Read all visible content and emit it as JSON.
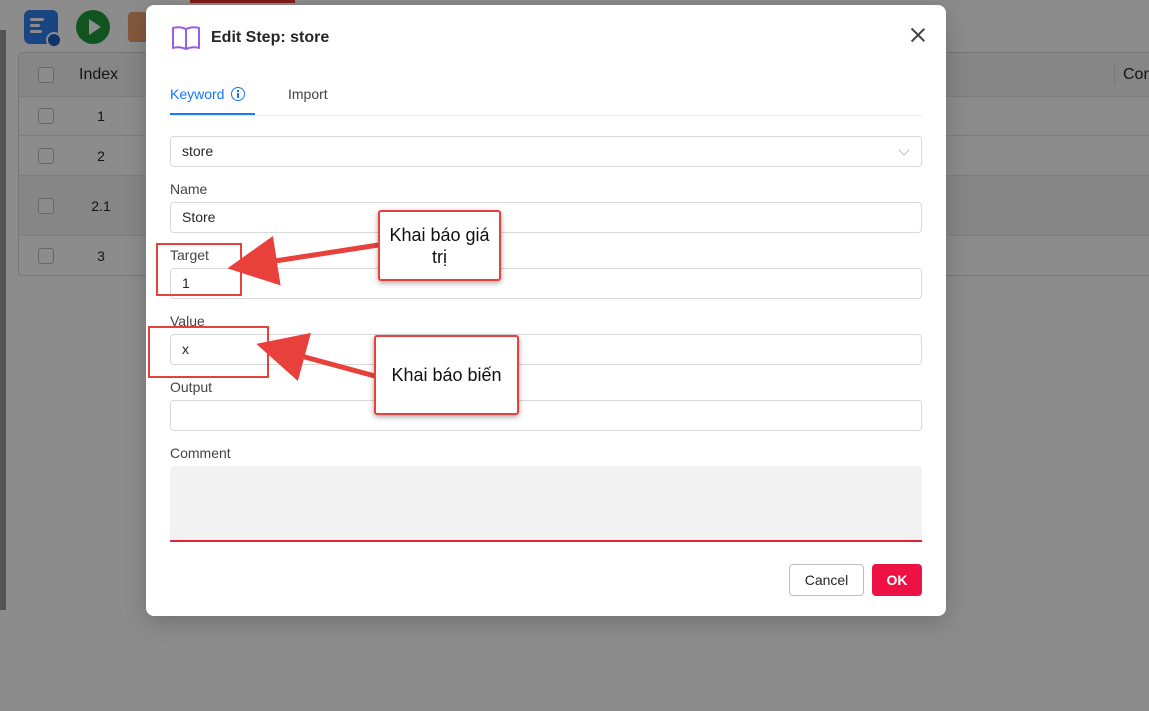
{
  "table": {
    "header": {
      "index": "Index",
      "comment_partial": "Con"
    },
    "rows": [
      {
        "index": "1"
      },
      {
        "index": "2"
      },
      {
        "index": "2.1"
      },
      {
        "index": "3"
      }
    ]
  },
  "modal": {
    "title": "Edit Step: store",
    "tabs": {
      "keyword": "Keyword",
      "import": "Import"
    },
    "keyword_select": "store",
    "fields": {
      "name_label": "Name",
      "name_value": "Store",
      "target_label": "Target",
      "target_value": "1",
      "value_label": "Value",
      "value_value": "x",
      "output_label": "Output",
      "output_value": "",
      "comment_label": "Comment",
      "comment_value": ""
    },
    "buttons": {
      "cancel": "Cancel",
      "ok": "OK"
    }
  },
  "annotations": {
    "callout_target": "Khai báo giá trị",
    "callout_value": "Khai báo biến",
    "color": "#e8413b"
  },
  "colors": {
    "accent": "#1677ff",
    "primary_button": "#ee1144"
  }
}
